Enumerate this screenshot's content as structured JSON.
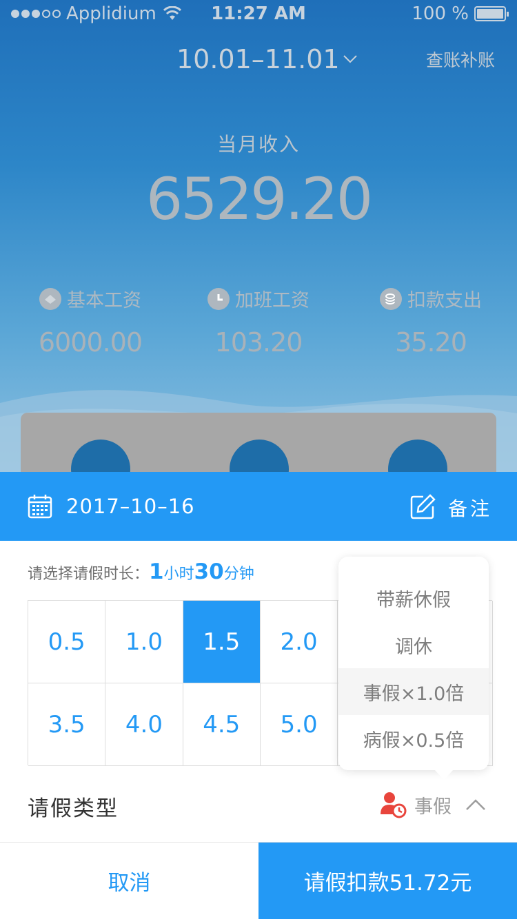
{
  "status_bar": {
    "carrier": "Applidium",
    "time": "11:27 AM",
    "battery": "100 %"
  },
  "header": {
    "period": "10.01–11.01",
    "audit_link": "查账补账"
  },
  "summary": {
    "income_label": "当月收入",
    "income_value": "6529.20",
    "stats": [
      {
        "label": "基本工资",
        "value": "6000.00",
        "icon": "wallet-icon"
      },
      {
        "label": "加班工资",
        "value": "103.20",
        "icon": "clock-icon"
      },
      {
        "label": "扣款支出",
        "value": "35.20",
        "icon": "coins-icon"
      }
    ]
  },
  "sheet": {
    "date": "2017–10–16",
    "note_label": "备注",
    "prompt_label": "请选择请假时长：",
    "hours": "1",
    "hours_unit": "小时",
    "minutes": "30",
    "minutes_unit": "分钟",
    "durations": [
      "0.5",
      "1.0",
      "1.5",
      "2.0",
      "",
      "",
      "3.5",
      "4.0",
      "4.5",
      "5.0",
      "",
      ""
    ],
    "selected_duration": "1.5",
    "leave_type_label": "请假类型",
    "leave_type_value": "事假",
    "leave_options": [
      "带薪休假",
      "调休",
      "事假×1.0倍",
      "病假×0.5倍"
    ],
    "highlighted_option": "事假×1.0倍"
  },
  "footer": {
    "cancel": "取消",
    "submit": "请假扣款51.72元"
  },
  "colors": {
    "accent": "#2399f5",
    "warning": "#e8453c"
  }
}
